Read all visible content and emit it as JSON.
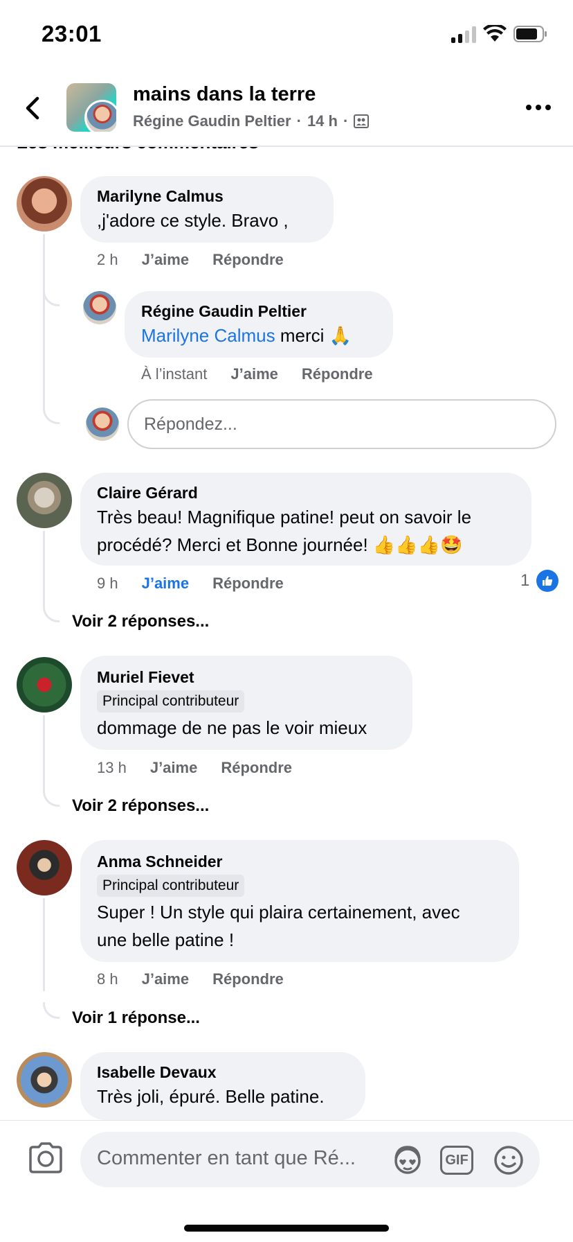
{
  "status_bar": {
    "time": "23:01"
  },
  "header": {
    "title": "mains dans la terre",
    "author": "Régine Gaudin Peltier",
    "time": "14 h",
    "separator": "·",
    "partial_heading": "Les meilleurs commentaires"
  },
  "comments": [
    {
      "name": "Marilyne Calmus",
      "text": ",j'adore ce style.  Bravo ,",
      "time": "2 h",
      "like": "J’aime",
      "reply": "Répondre"
    },
    {
      "name": "Régine Gaudin Peltier",
      "mention": "Marilyne Calmus",
      "text": " merci 🙏",
      "time": "À l’instant",
      "like": "J’aime",
      "reply": "Répondre",
      "reply_placeholder": "Répondez..."
    },
    {
      "name": "Claire Gérard",
      "text_line1": "Très beau! Magnifique patine! peut on savoir le",
      "text_line2": "procédé? Merci et Bonne journée! 👍👍👍🤩",
      "time": "9 h",
      "like": "J’aime",
      "reply": "Répondre",
      "like_count": "1",
      "see_replies": "Voir 2 réponses..."
    },
    {
      "name": "Muriel Fievet",
      "badge": "Principal contributeur",
      "text": "dommage de ne pas le voir mieux",
      "time": "13 h",
      "like": "J’aime",
      "reply": "Répondre",
      "see_replies": "Voir 2 réponses..."
    },
    {
      "name": "Anma Schneider",
      "badge": "Principal contributeur",
      "text_line1": "Super ! Un style qui plaira certainement, avec",
      "text_line2": "une belle patine !",
      "time": "8 h",
      "like": "J’aime",
      "reply": "Répondre",
      "see_replies": "Voir 1 réponse..."
    },
    {
      "name": "Isabelle Devaux",
      "text": "Très joli, épuré. Belle patine."
    }
  ],
  "composer": {
    "placeholder": "Commenter en tant que Ré...",
    "gif_label": "GIF"
  },
  "colors": {
    "accent": "#1b74e4",
    "bubble": "#f0f2f5",
    "muted": "#65676b"
  }
}
